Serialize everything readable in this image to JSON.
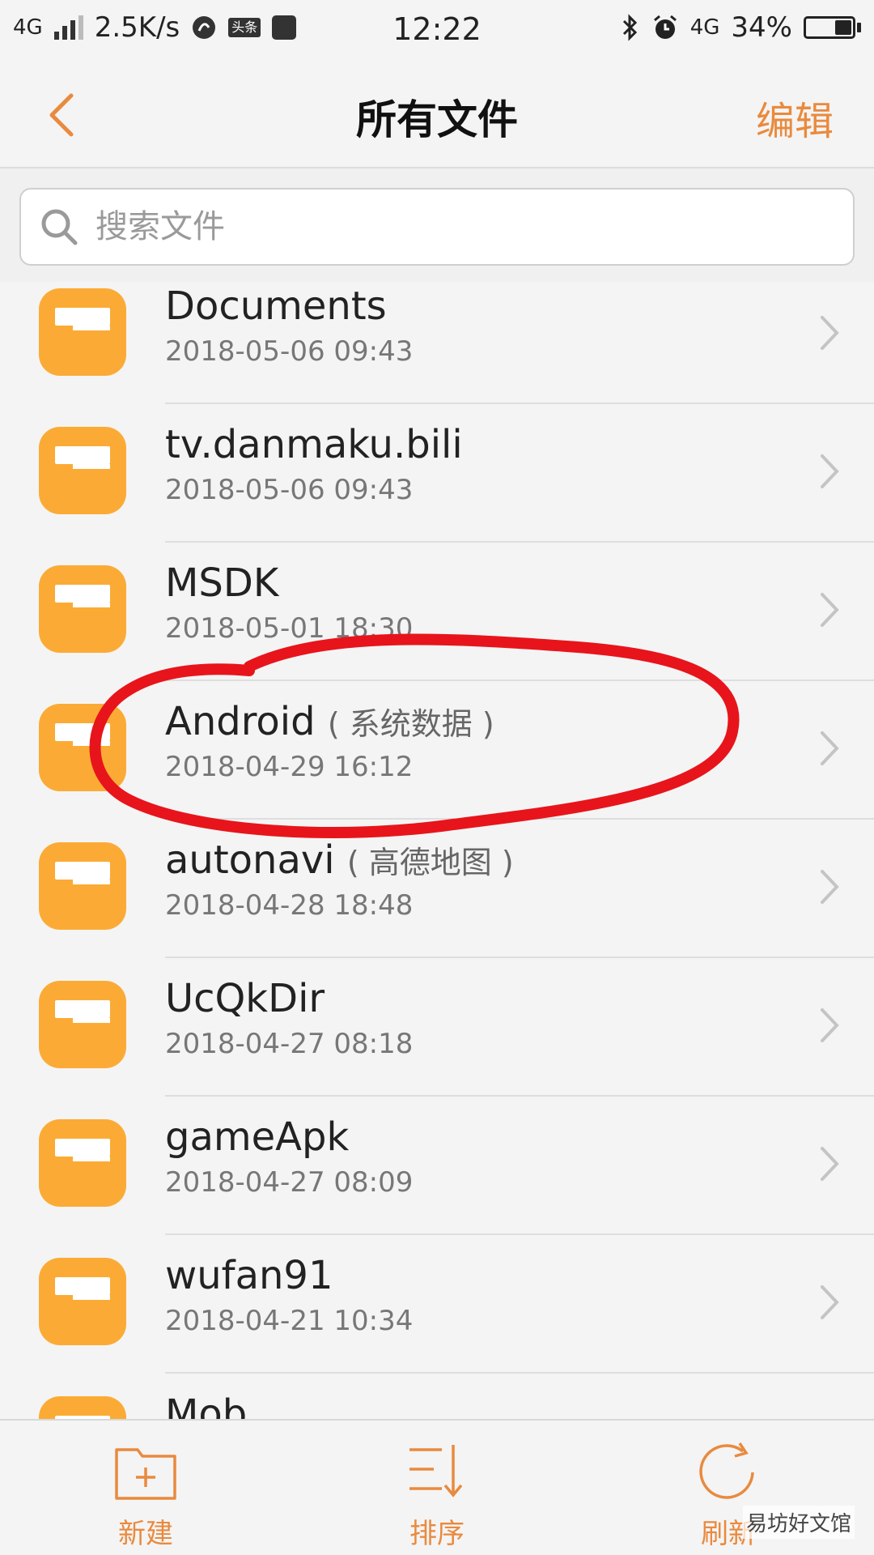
{
  "status_bar": {
    "network": "4G",
    "speed": "2.5K/s",
    "app_badge": "头条",
    "time": "12:22",
    "network_right": "4G",
    "battery": "34%",
    "battery_level": 0.34
  },
  "header": {
    "title": "所有文件",
    "edit_label": "编辑"
  },
  "search": {
    "placeholder": "搜索文件"
  },
  "files": [
    {
      "name": "Documents",
      "subtitle": "",
      "date": "2018-05-06 09:43"
    },
    {
      "name": "tv.danmaku.bili",
      "subtitle": "",
      "date": "2018-05-06 09:43"
    },
    {
      "name": "MSDK",
      "subtitle": "",
      "date": "2018-05-01 18:30"
    },
    {
      "name": "Android",
      "subtitle": "( 系统数据 )",
      "date": "2018-04-29 16:12"
    },
    {
      "name": "autonavi",
      "subtitle": "( 高德地图 )",
      "date": "2018-04-28 18:48"
    },
    {
      "name": "UcQkDir",
      "subtitle": "",
      "date": "2018-04-27 08:18"
    },
    {
      "name": "gameApk",
      "subtitle": "",
      "date": "2018-04-27 08:09"
    },
    {
      "name": "wufan91",
      "subtitle": "",
      "date": "2018-04-21 10:34"
    },
    {
      "name": "Mob",
      "subtitle": "",
      "date": ""
    }
  ],
  "toolbar": {
    "new_label": "新建",
    "sort_label": "排序",
    "refresh_label": "刷新"
  },
  "watermark": "易坊好文馆",
  "colors": {
    "accent": "#e98a3e",
    "folder": "#fbab35",
    "annotation": "#e8141b"
  },
  "icons": {
    "back": "chevron-left-icon",
    "search": "search-icon",
    "folder": "folder-icon",
    "chevron": "chevron-right-icon",
    "new": "new-folder-icon",
    "sort": "sort-icon",
    "refresh": "refresh-icon"
  }
}
